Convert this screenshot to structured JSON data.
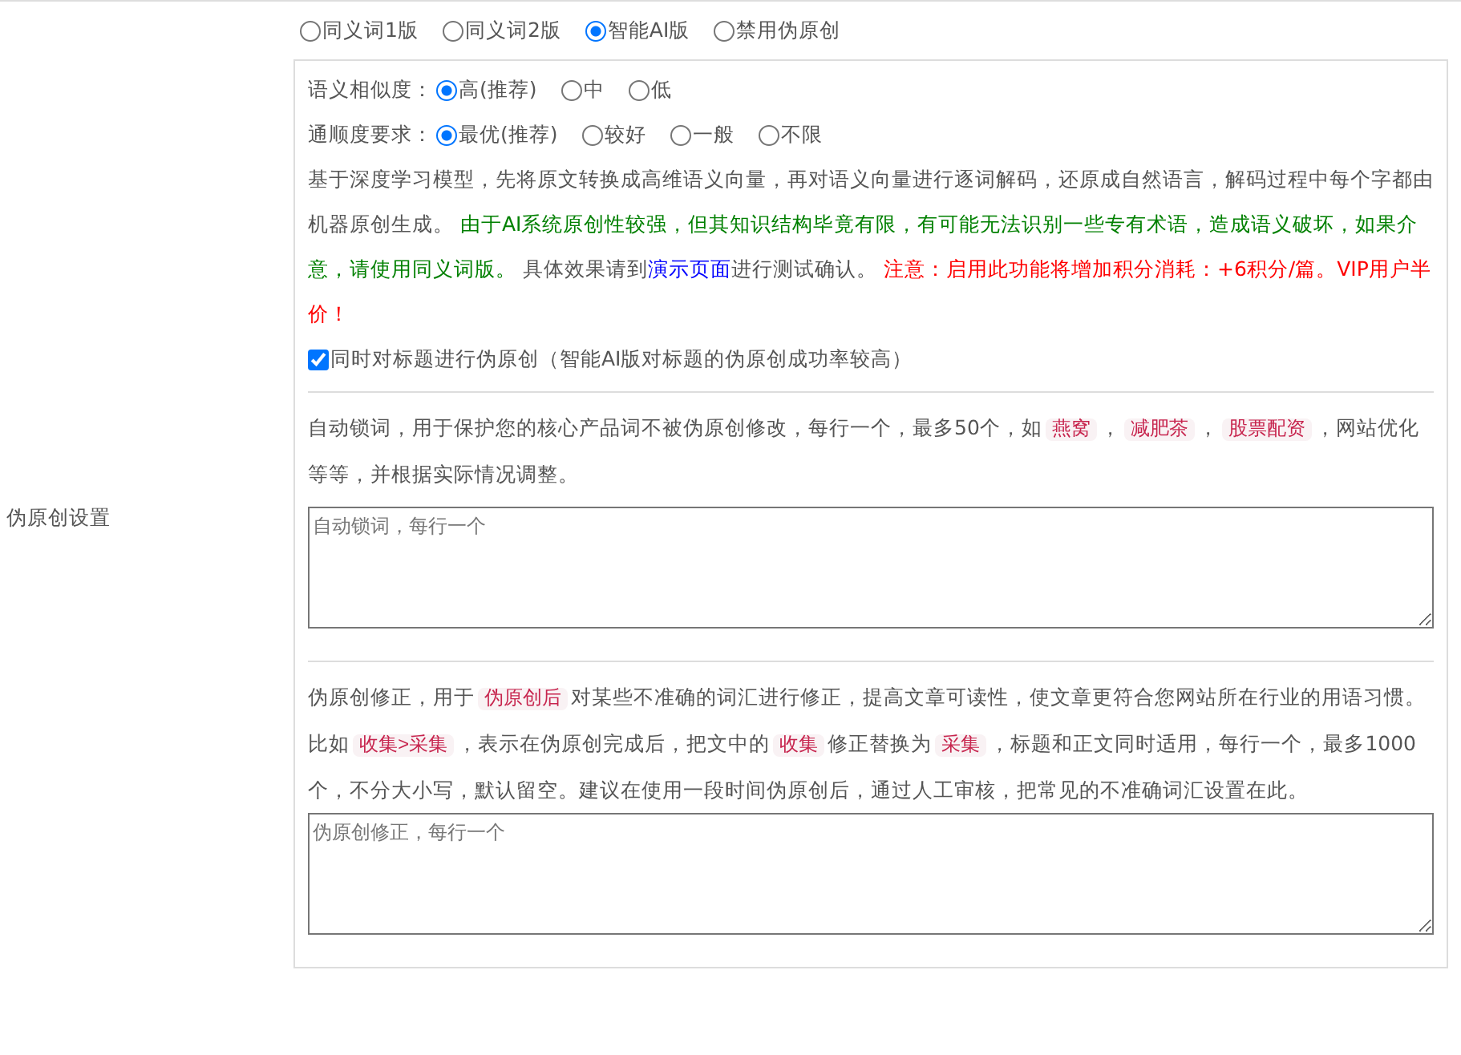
{
  "side_label": "伪原创设置",
  "modes": [
    {
      "label": "同义词1版",
      "selected": false
    },
    {
      "label": "同义词2版",
      "selected": false
    },
    {
      "label": "智能AI版",
      "selected": true
    },
    {
      "label": "禁用伪原创",
      "selected": false
    }
  ],
  "similarity": {
    "label": "语义相似度：",
    "options": [
      {
        "label": "高(推荐)",
        "selected": true
      },
      {
        "label": "中",
        "selected": false
      },
      {
        "label": "低",
        "selected": false
      }
    ]
  },
  "fluency": {
    "label": "通顺度要求：",
    "options": [
      {
        "label": "最优(推荐)",
        "selected": true
      },
      {
        "label": "较好",
        "selected": false
      },
      {
        "label": "一般",
        "selected": false
      },
      {
        "label": "不限",
        "selected": false
      }
    ]
  },
  "description": [
    {
      "kind": "text",
      "text": "基于深度学习模型，先将原文转换成高维语义向量，再对语义向量进行逐词解码，还原成自然语言，解码过程中每个字都由机器原创生成。 "
    },
    {
      "kind": "green",
      "text": "由于AI系统原创性较强，但其知识结构毕竟有限，有可能无法识别一些专有术语，造成语义破坏，如果介意，请使用同义词版。"
    },
    {
      "kind": "text",
      "text": " 具体效果请到"
    },
    {
      "kind": "link",
      "text": "演示页面"
    },
    {
      "kind": "text",
      "text": "进行测试确认。 "
    },
    {
      "kind": "red",
      "text": "注意：启用此功能将增加积分消耗：+6积分/篇。VIP用户半价！"
    }
  ],
  "title_option": {
    "label": "同时对标题进行伪原创（智能AI版对标题的伪原创成功率较高）",
    "checked": true
  },
  "lock_words": {
    "description": [
      {
        "kind": "text",
        "text": "自动锁词，用于保护您的核心产品词不被伪原创修改，每行一个，最多50个，如"
      },
      {
        "kind": "code",
        "text": "燕窝"
      },
      {
        "kind": "text",
        "text": "，"
      },
      {
        "kind": "code",
        "text": "减肥茶"
      },
      {
        "kind": "text",
        "text": "，"
      },
      {
        "kind": "code",
        "text": "股票配资"
      },
      {
        "kind": "text",
        "text": "，网站优化等等，并根据实际情况调整。"
      }
    ],
    "placeholder": "自动锁词，每行一个"
  },
  "corrections": {
    "description": [
      {
        "kind": "text",
        "text": "伪原创修正，用于"
      },
      {
        "kind": "code",
        "text": "伪原创后"
      },
      {
        "kind": "text",
        "text": "对某些不准确的词汇进行修正，提高文章可读性，使文章更符合您网站所在行业的用语习惯。比如"
      },
      {
        "kind": "code",
        "text": "收集>采集"
      },
      {
        "kind": "text",
        "text": "，表示在伪原创完成后，把文中的"
      },
      {
        "kind": "code",
        "text": "收集"
      },
      {
        "kind": "text",
        "text": "修正替换为"
      },
      {
        "kind": "code",
        "text": "采集"
      },
      {
        "kind": "text",
        "text": "，标题和正文同时适用，每行一个，最多1000个，不分大小写，默认留空。建议在使用一段时间伪原创后，通过人工审核，把常见的不准确词汇设置在此。"
      }
    ],
    "placeholder": "伪原创修正，每行一个"
  }
}
